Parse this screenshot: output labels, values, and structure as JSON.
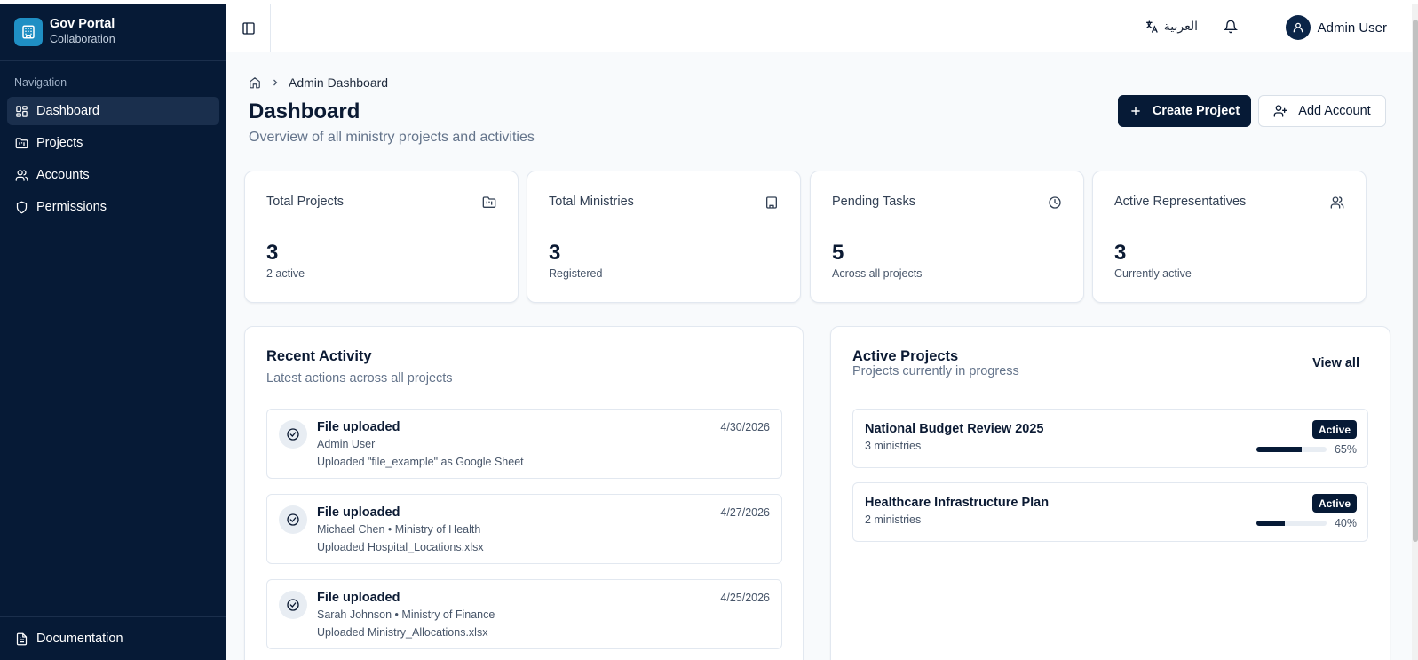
{
  "brand": {
    "title": "Gov Portal",
    "subtitle": "Collaboration"
  },
  "sidebar": {
    "heading": "Navigation",
    "items": [
      {
        "label": "Dashboard",
        "icon": "dashboard-icon",
        "active": true
      },
      {
        "label": "Projects",
        "icon": "folder-kanban-icon"
      },
      {
        "label": "Accounts",
        "icon": "users-icon"
      },
      {
        "label": "Permissions",
        "icon": "shield-icon"
      }
    ],
    "footer": "Documentation"
  },
  "header": {
    "language": "العربية",
    "user_name": "Admin User"
  },
  "breadcrumb": {
    "current": "Admin Dashboard"
  },
  "page": {
    "title": "Dashboard",
    "subtitle": "Overview of all ministry projects and activities",
    "create_label": "Create Project",
    "add_account_label": "Add Account"
  },
  "stats": [
    {
      "label": "Total Projects",
      "value": "3",
      "note": "2 active",
      "icon": "folder-icon"
    },
    {
      "label": "Total Ministries",
      "value": "3",
      "note": "Registered",
      "icon": "building-icon"
    },
    {
      "label": "Pending Tasks",
      "value": "5",
      "note": "Across all projects",
      "icon": "clock-icon"
    },
    {
      "label": "Active Representatives",
      "value": "3",
      "note": "Currently active",
      "icon": "users-icon"
    }
  ],
  "activity": {
    "title": "Recent Activity",
    "subtitle": "Latest actions across all projects",
    "items": [
      {
        "title": "File uploaded",
        "user": "Admin User",
        "desc": "Uploaded \"file_example\" as Google Sheet",
        "date": "4/30/2026"
      },
      {
        "title": "File uploaded",
        "user": "Michael Chen • Ministry of Health",
        "desc": "Uploaded Hospital_Locations.xlsx",
        "date": "4/27/2026"
      },
      {
        "title": "File uploaded",
        "user": "Sarah Johnson • Ministry of Finance",
        "desc": "Uploaded Ministry_Allocations.xlsx",
        "date": "4/25/2026"
      }
    ]
  },
  "projects": {
    "title": "Active Projects",
    "subtitle": "Projects currently in progress",
    "view_all": "View all",
    "items": [
      {
        "name": "National Budget Review 2025",
        "ministries": "3 ministries",
        "status": "Active",
        "progress": 65,
        "progress_label": "65%"
      },
      {
        "name": "Healthcare Infrastructure Plan",
        "ministries": "2 ministries",
        "status": "Active",
        "progress": 40,
        "progress_label": "40%"
      }
    ]
  },
  "colors": {
    "navy": "#061a36",
    "accent": "#1f8fc4",
    "muted": "#64748b"
  }
}
